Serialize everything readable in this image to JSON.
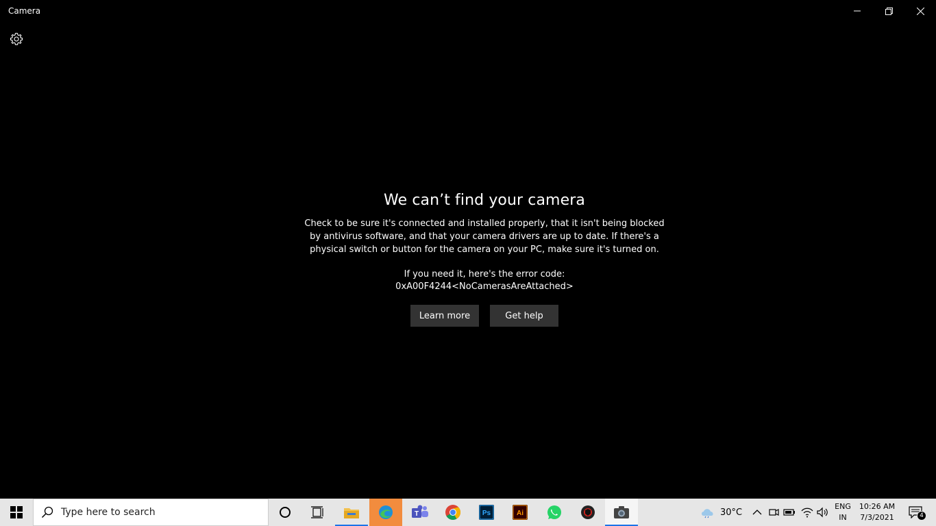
{
  "window": {
    "title": "Camera"
  },
  "error": {
    "heading": "We can’t find your camera",
    "description_lines": [
      "Check to be sure it's connected and installed properly, that it isn't being blocked",
      "by antivirus software, and that your camera drivers are up to date. If there's a",
      "physical switch or button for the camera on your PC, make sure it's turned on."
    ],
    "code_label": "If you need it, here's the error code:",
    "code": "0xA00F4244<NoCamerasAreAttached>",
    "learn_more": "Learn more",
    "get_help": "Get help"
  },
  "taskbar": {
    "search_placeholder": "Type here to search",
    "pinned": [
      "cortana-icon",
      "task-view-icon",
      "file-explorer-icon",
      "edge-icon",
      "teams-icon",
      "chrome-icon",
      "photoshop-icon",
      "illustrator-icon",
      "whatsapp-icon",
      "game-app-icon",
      "camera-icon"
    ],
    "weather": "30°C",
    "lang_top": "ENG",
    "lang_bottom": "IN",
    "time": "10:26 AM",
    "date": "7/3/2021",
    "notification_count": "4"
  },
  "colors": {
    "background": "#000000",
    "button": "#333333",
    "taskbar": "#e6e6e6",
    "accent": "#1a73e8"
  }
}
